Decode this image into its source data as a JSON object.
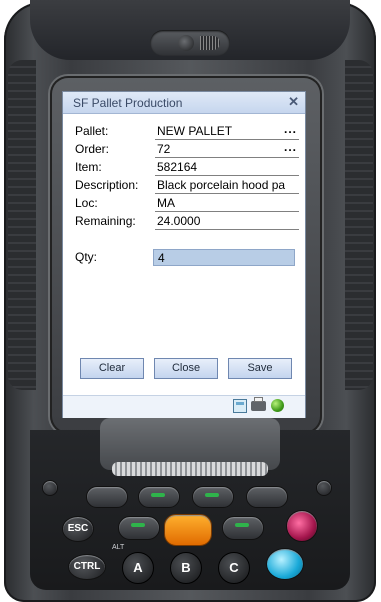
{
  "window": {
    "title": "SF Pallet Production",
    "close_glyph": "✕"
  },
  "form": {
    "fields": [
      {
        "label": "Pallet:",
        "value": "NEW PALLET",
        "has_lookup": true
      },
      {
        "label": "Order:",
        "value": "72",
        "has_lookup": true
      },
      {
        "label": "Item:",
        "value": "582164",
        "has_lookup": false
      },
      {
        "label": "Description:",
        "value": "Black porcelain hood pa",
        "has_lookup": false
      },
      {
        "label": "Loc:",
        "value": "MA",
        "has_lookup": false
      },
      {
        "label": "Remaining:",
        "value": "24.0000",
        "has_lookup": false
      }
    ],
    "lookup_glyph": "...",
    "qty_label": "Qty:",
    "qty_value": "4"
  },
  "buttons": {
    "clear": "Clear",
    "close": "Close",
    "save": "Save"
  },
  "status_icons": [
    "calculator-icon",
    "printer-icon",
    "connection-status-icon"
  ],
  "keypad": {
    "esc": "ESC",
    "ctrl": "CTRL",
    "alt": "ALT",
    "letters": [
      "A",
      "B",
      "C"
    ]
  },
  "colors": {
    "titlebar": "#c6d6ee",
    "qty_highlight": "#b8cde6",
    "button_border": "#6f87b0",
    "status_green": "#3f9a1a",
    "orange_key": "#e06b00",
    "blue_key": "#19a9d8",
    "pink_key": "#a3154c"
  }
}
